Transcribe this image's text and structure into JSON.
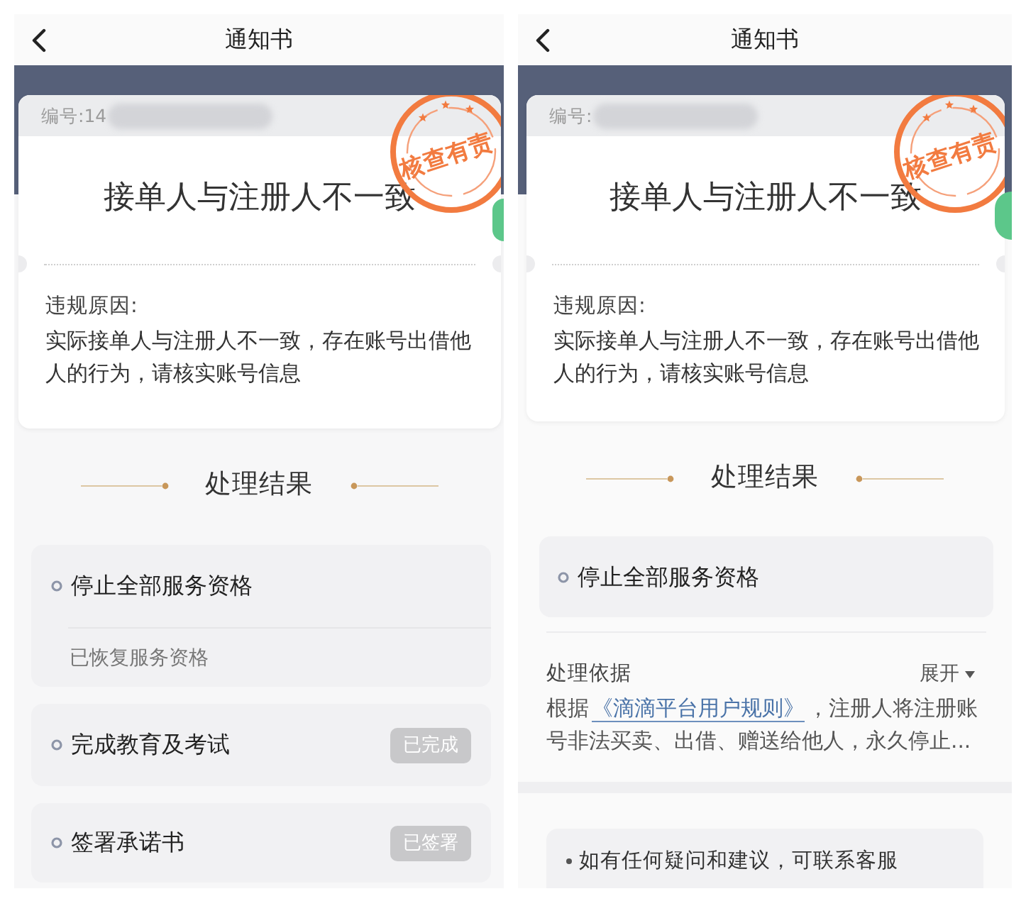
{
  "panels": [
    {
      "header": {
        "title": "通知书"
      },
      "notice": {
        "number_label": "编号:14",
        "stamp_text": "核查有责",
        "title": "接单人与注册人不一致",
        "reason_label": "违规原因:",
        "reason": "实际接单人与注册人不一致，存在账号出借他人的行为，请核实账号信息"
      },
      "result_heading": "处理结果",
      "results": [
        {
          "kind": "status",
          "title": "停止全部服务资格",
          "note": "已恢复服务资格"
        },
        {
          "kind": "task",
          "title": "完成教育及考试",
          "tag": "已完成"
        },
        {
          "kind": "task",
          "title": "签署承诺书",
          "tag": "已签署"
        }
      ]
    },
    {
      "header": {
        "title": "通知书"
      },
      "notice": {
        "number_label": "编号:",
        "stamp_text": "核查有责",
        "title": "接单人与注册人不一致",
        "reason_label": "违规原因:",
        "reason": "实际接单人与注册人不一致，存在账号出借他人的行为，请核实账号信息"
      },
      "result_heading": "处理结果",
      "results": [
        {
          "kind": "status",
          "title": "停止全部服务资格"
        }
      ],
      "basis": {
        "label": "处理依据",
        "toggle": "展开",
        "text_before": "根据",
        "link": "《滴滴平台用户规则》",
        "text_after": "，注册人将注册账号非法买卖、出借、赠送给他人，永久停止..."
      },
      "help": {
        "text": "如有任何疑问和建议，可联系客服"
      }
    }
  ]
}
